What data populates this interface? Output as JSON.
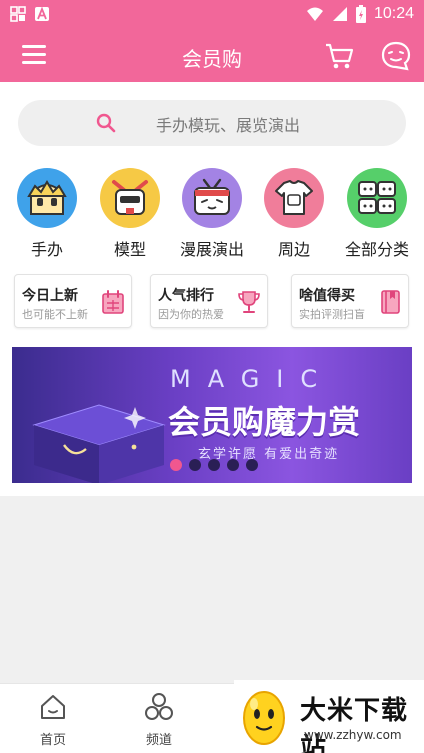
{
  "status_bar": {
    "time": "10:24"
  },
  "app_bar": {
    "title": "会员购"
  },
  "search": {
    "placeholder": "手办模玩、展览演出"
  },
  "categories": [
    {
      "label": "手办",
      "color": "#3fa2ea"
    },
    {
      "label": "模型",
      "color": "#f6c945"
    },
    {
      "label": "漫展演出",
      "color": "#a383e4"
    },
    {
      "label": "周边",
      "color": "#f07d9a"
    },
    {
      "label": "全部分类",
      "color": "#56cf6a"
    }
  ],
  "cards": [
    {
      "title": "今日上新",
      "subtitle": "也可能不上新",
      "icon": "calendar-icon"
    },
    {
      "title": "人气排行",
      "subtitle": "因为你的热爱",
      "icon": "trophy-icon"
    },
    {
      "title": "啥值得买",
      "subtitle": "实拍评测扫盲",
      "icon": "book-icon"
    }
  ],
  "banner": {
    "word": "MAGIC",
    "headline": "会员购魔力赏",
    "subtitle": "玄学许愿 有爱出奇迹",
    "slide_count": 5,
    "active_slide": 1
  },
  "tabs": [
    {
      "label": "首页",
      "icon": "home-icon"
    },
    {
      "label": "频道",
      "icon": "channel-icon"
    }
  ],
  "watermark": {
    "name": "大米下载站",
    "url": "www.zzhyw.com"
  },
  "colors": {
    "brand": "#f2679a",
    "banner": "#6a3fc4"
  }
}
